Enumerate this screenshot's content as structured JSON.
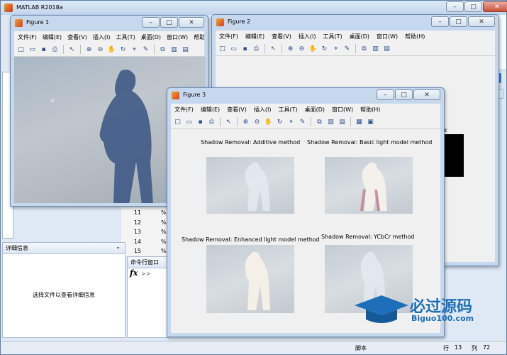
{
  "main": {
    "title": "MATLAB R2018a",
    "details_header": "详细信息",
    "details_hint": "选择文件以查看详细信息",
    "command_window": "命令行窗口",
    "prompt": ">>",
    "fx": "fx",
    "line_numbers": [
      "11",
      "12",
      "13",
      "14",
      "15"
    ],
    "line_marks": [
      "%",
      "%",
      "%",
      "%",
      "%"
    ],
    "status": {
      "script": "脚本",
      "row_label": "行",
      "row": "13",
      "col_label": "列",
      "col": "72"
    }
  },
  "menus": [
    "文件(F)",
    "编辑(E)",
    "查看(V)",
    "插入(I)",
    "工具(T)",
    "桌面(D)",
    "窗口(W)",
    "帮助(H)"
  ],
  "figure1": {
    "title": "Figure 1"
  },
  "figure2": {
    "title": "Figure 2",
    "partial_text": "k"
  },
  "figure3": {
    "title": "Figure 3",
    "plots": [
      {
        "title": "Shadow Removal: Additive method"
      },
      {
        "title": "Shadow Removal: Basic light model method"
      },
      {
        "title": "Shadow Removal: Enhanced light model method"
      },
      {
        "title": "Shadow Removal: YCbCr method"
      }
    ]
  },
  "watermark": {
    "text": "必过源码",
    "url": "Biguo100.com"
  },
  "colors": {
    "title_bar": "#c6d8ee",
    "figure_bg": "#f0f0f0",
    "close_button": "#c7523b"
  }
}
